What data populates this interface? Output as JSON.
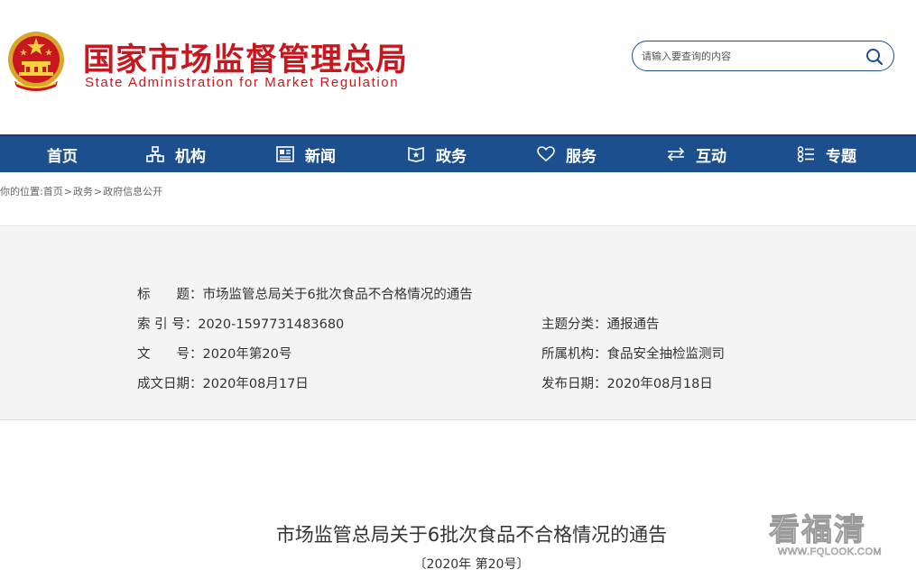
{
  "header": {
    "logo_cn": "国家市场监督管理总局",
    "logo_en": "State Administration for Market Regulation",
    "emblem_icon": "national-emblem-icon",
    "brand_color": "#c8171e"
  },
  "search": {
    "placeholder": "请输入要查询的内容",
    "icon": "search-icon"
  },
  "nav": {
    "background": "#1c4f8d",
    "items": [
      {
        "label": "首页",
        "icon": ""
      },
      {
        "label": "机构",
        "icon": "org-chart-icon"
      },
      {
        "label": "新闻",
        "icon": "news-icon"
      },
      {
        "label": "政务",
        "icon": "government-affairs-icon"
      },
      {
        "label": "服务",
        "icon": "heart-icon"
      },
      {
        "label": "互动",
        "icon": "exchange-arrows-icon"
      },
      {
        "label": "专题",
        "icon": "topics-icon"
      }
    ]
  },
  "breadcrumb": {
    "prefix": "你的位置:",
    "items": [
      "首页",
      "政务",
      "政府信息公开"
    ],
    "separator": ">"
  },
  "meta": {
    "title_label": "标　　题：",
    "title_value": "市场监管总局关于6批次食品不合格情况的通告",
    "index_label": "索 引 号：",
    "index_value": "2020-1597731483680",
    "topic_label": "主题分类：",
    "topic_value": "通报通告",
    "docno_label": "文　　号：",
    "docno_value": "2020年第20号",
    "agency_label": "所属机构：",
    "agency_value": "食品安全抽检监测司",
    "written_label": "成文日期：",
    "written_value": "2020年08月17日",
    "published_label": "发布日期：",
    "published_value": "2020年08月18日"
  },
  "document": {
    "title": "市场监管总局关于6批次食品不合格情况的通告",
    "subtitle": "〔2020年 第20号〕"
  },
  "watermark": {
    "cn": "看福清",
    "en": "WWW.FQLOOK.COM"
  }
}
